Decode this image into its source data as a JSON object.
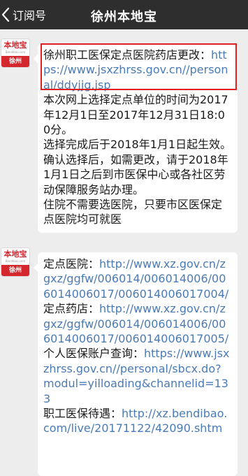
{
  "header": {
    "back_label": "订阅号",
    "title": "徐州本地宝"
  },
  "avatar": {
    "brand": "本地宝",
    "site": "Bendibao.com",
    "city": "徐州"
  },
  "message1": {
    "title": "徐州职工医保定点医院药店更改：",
    "link": "https://www.jsxzhrss.gov.cn//personal/ddyjjg.jsp",
    "para1": "本次网上选择定点单位的时间为2017年12月1日至2017年12月31日18:00分。",
    "para2": "选择完成后于2018年1月1日起生效。",
    "para3": "确认选择后，如需更改，请于2018年1月1日之后到市医保中心或各社区劳动保障服务站办理。",
    "para4": "住院不需要选医院，只要市区医保定点医院均可就医"
  },
  "message2": {
    "hospital_label": "定点医院：",
    "hospital_link": "http://www.xz.gov.cn/zgxz/ggfw/006014/006014006/006014006017/006014006017004/",
    "pharmacy_label": "定点药店：",
    "pharmacy_link": "http://www.xz.gov.cn/zgxz/ggfw/006014/006014006/006014006017/006014006017005/",
    "account_label": "个人医保账户查询：",
    "account_link": "https://www.jsxzhrss.gov.cn//personal/sbcx.do?modul=yilloading&channelid=133",
    "treatment_label": "职工医保待遇：",
    "treatment_link": "http://xz.bendibao.com/live/20171122/42090.shtm"
  }
}
